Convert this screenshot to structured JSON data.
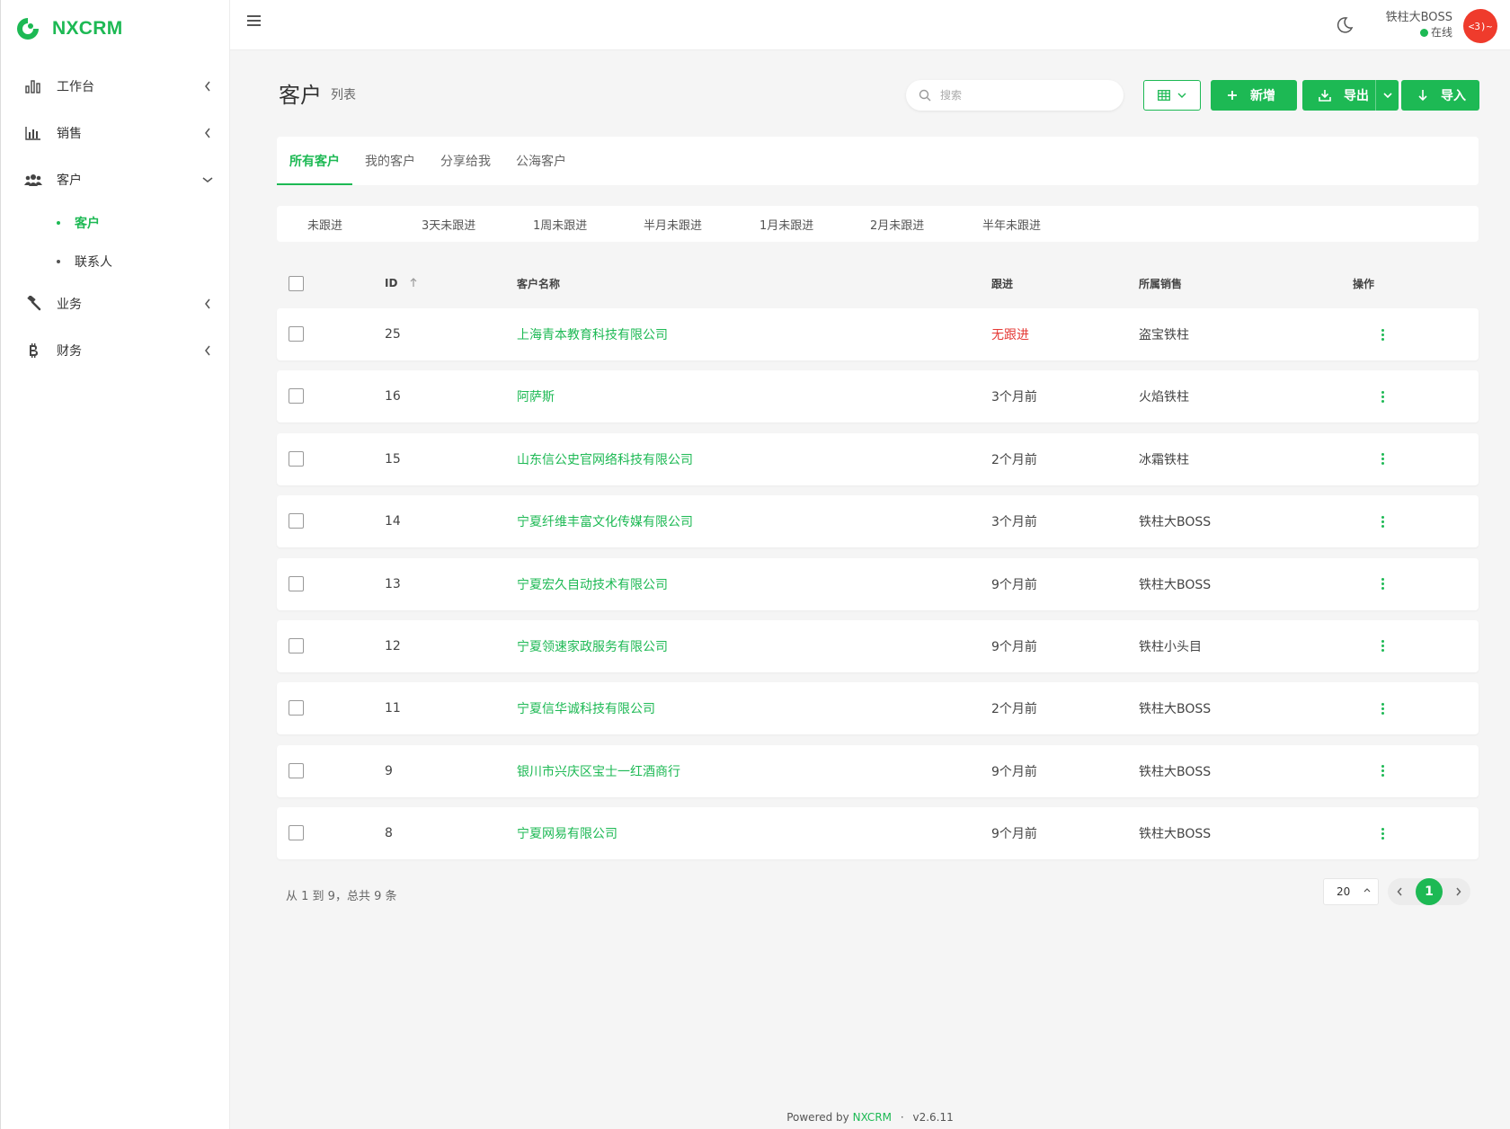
{
  "brand": {
    "name": "NXCRM"
  },
  "sidebar": {
    "items": [
      {
        "label": "工作台",
        "icon": "bar-chart-icon"
      },
      {
        "label": "销售",
        "icon": "stats-icon"
      },
      {
        "label": "客户",
        "icon": "users-icon",
        "expanded": true,
        "children": [
          {
            "label": "客户",
            "active": true
          },
          {
            "label": "联系人"
          }
        ]
      },
      {
        "label": "业务",
        "icon": "hammer-icon"
      },
      {
        "label": "财务",
        "icon": "bitcoin-icon"
      }
    ]
  },
  "header": {
    "user_name": "铁柱大BOSS",
    "user_status": "在线",
    "avatar_text": "<3)~"
  },
  "page": {
    "title": "客户",
    "subtitle": "列表",
    "search_placeholder": "搜索",
    "buttons": {
      "add": "新增",
      "export": "导出",
      "import": "导入"
    }
  },
  "tabs": [
    {
      "label": "所有客户",
      "active": true
    },
    {
      "label": "我的客户"
    },
    {
      "label": "分享给我"
    },
    {
      "label": "公海客户"
    }
  ],
  "filters": [
    "未跟进",
    "3天未跟进",
    "1周未跟进",
    "半月未跟进",
    "1月未跟进",
    "2月未跟进",
    "半年未跟进"
  ],
  "table": {
    "headers": {
      "id": "ID",
      "name": "客户名称",
      "follow": "跟进",
      "sales": "所属销售",
      "op": "操作"
    },
    "rows": [
      {
        "id": "25",
        "name": "上海青本教育科技有限公司",
        "follow": "无跟进",
        "sales": "盗宝铁柱"
      },
      {
        "id": "16",
        "name": "阿萨斯",
        "follow": "3个月前",
        "sales": "火焰铁柱"
      },
      {
        "id": "15",
        "name": "山东信公史官网络科技有限公司",
        "follow": "2个月前",
        "sales": "冰霜铁柱"
      },
      {
        "id": "14",
        "name": "宁夏纤维丰富文化传媒有限公司",
        "follow": "3个月前",
        "sales": "铁柱大BOSS"
      },
      {
        "id": "13",
        "name": "宁夏宏久自动技术有限公司",
        "follow": "9个月前",
        "sales": "铁柱大BOSS"
      },
      {
        "id": "12",
        "name": "宁夏领速家政服务有限公司",
        "follow": "9个月前",
        "sales": "铁柱小头目"
      },
      {
        "id": "11",
        "name": "宁夏信华诚科技有限公司",
        "follow": "2个月前",
        "sales": "铁柱大BOSS"
      },
      {
        "id": "9",
        "name": "银川市兴庆区宝士一红酒商行",
        "follow": "9个月前",
        "sales": "铁柱大BOSS"
      },
      {
        "id": "8",
        "name": "宁夏网易有限公司",
        "follow": "9个月前",
        "sales": "铁柱大BOSS"
      }
    ]
  },
  "pagination": {
    "summary": "从 1 到 9，总共 9 条",
    "page_size": "20",
    "current_page": "1"
  },
  "footer": {
    "prefix": "Powered by",
    "brand": "NXCRM",
    "sep": "·",
    "version": "v2.6.11"
  },
  "colors": {
    "accent": "#1db954",
    "danger": "#e53935",
    "avatar": "#ef3b2c"
  }
}
